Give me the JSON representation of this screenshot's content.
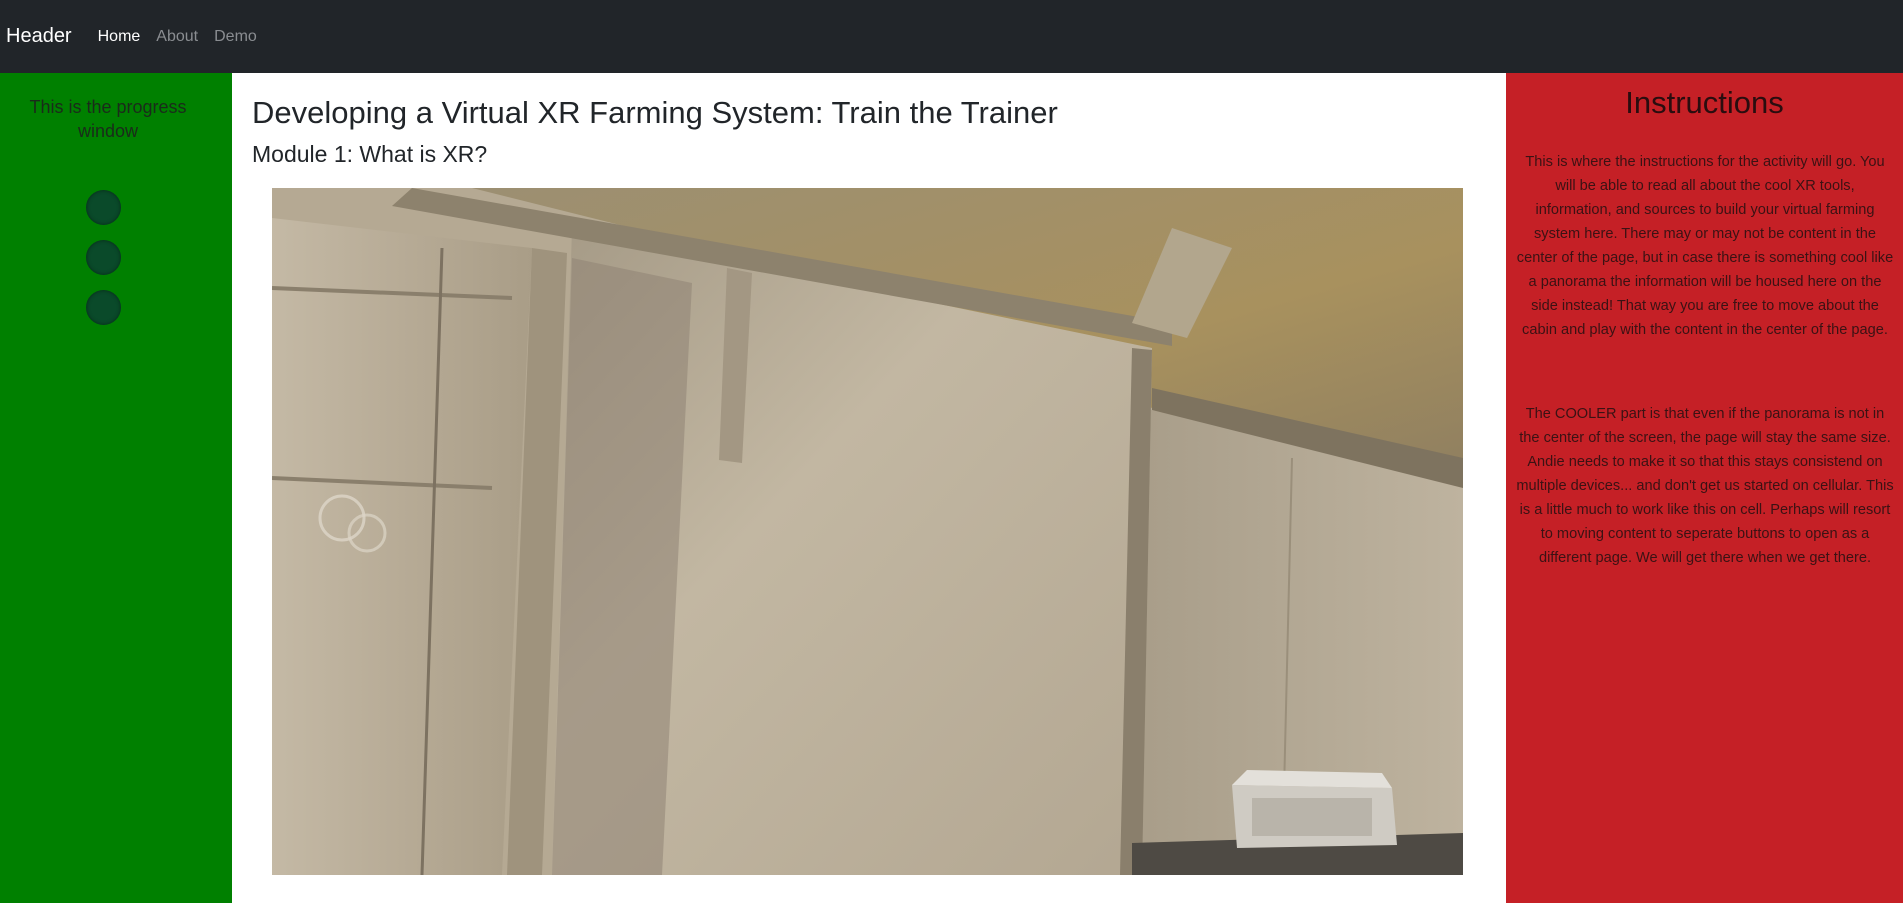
{
  "navbar": {
    "brand": "Header",
    "links": [
      {
        "label": "Home"
      },
      {
        "label": "About"
      },
      {
        "label": "Demo"
      }
    ]
  },
  "progress": {
    "title": "This is the progress window",
    "steps": 3
  },
  "main": {
    "title": "Developing a Virtual XR Farming System: Train the Trainer",
    "module": "Module 1: What is XR?"
  },
  "instructions": {
    "title": "Instructions",
    "paragraphs": [
      "This is where the instructions for the activity will go. You will be able to read all about the cool XR tools, information, and sources to build your virtual farming system here. There may or may not be content in the center of the page, but in case there is something cool like a panorama the information will be housed here on the side instead! That way you are free to move about the cabin and play with the content in the center of the page.",
      "The COOLER part is that even if the panorama is not in the center of the screen, the page will stay the same size. Andie needs to make it so that this stays consistend on multiple devices... and don't get us started on cellular. This is a little much to work like this on cell. Perhaps will resort to moving content to seperate buttons to open as a different page. We will get there when we get there."
    ]
  },
  "colors": {
    "navbar": "#212529",
    "progress_panel": "#008000",
    "instructions_panel": "#c52026"
  }
}
